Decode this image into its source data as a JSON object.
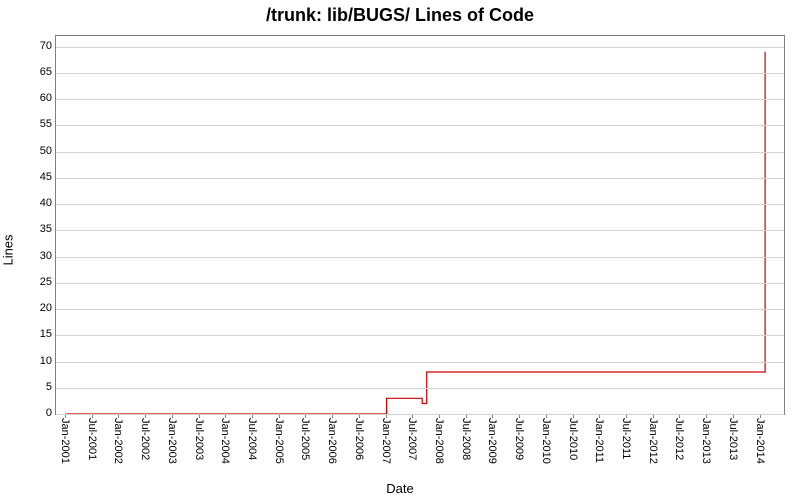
{
  "chart_data": {
    "type": "line",
    "title": "/trunk: lib/BUGS/ Lines of Code",
    "xlabel": "Date",
    "ylabel": "Lines",
    "ylim": [
      0,
      72
    ],
    "y_ticks": [
      0,
      5,
      10,
      15,
      20,
      25,
      30,
      35,
      40,
      45,
      50,
      55,
      60,
      65,
      70
    ],
    "x_categories": [
      "Jan-2001",
      "Jul-2001",
      "Jan-2002",
      "Jul-2002",
      "Jan-2003",
      "Jul-2003",
      "Jan-2004",
      "Jul-2004",
      "Jan-2005",
      "Jul-2005",
      "Jan-2006",
      "Jul-2006",
      "Jan-2007",
      "Jul-2007",
      "Jan-2008",
      "Jul-2008",
      "Jan-2009",
      "Jul-2009",
      "Jan-2010",
      "Jul-2010",
      "Jan-2011",
      "Jul-2011",
      "Jan-2012",
      "Jul-2012",
      "Jan-2013",
      "Jul-2013",
      "Jan-2014"
    ],
    "series": [
      {
        "name": "lines",
        "color": "#cc0000",
        "points": [
          {
            "x": "Jan-2001",
            "y": 0
          },
          {
            "x": "Jan-2007",
            "y": 0
          },
          {
            "x": "Jan-2007",
            "y": 3
          },
          {
            "x": "Sep-2007",
            "y": 3
          },
          {
            "x": "Sep-2007",
            "y": 2
          },
          {
            "x": "Oct-2007",
            "y": 2
          },
          {
            "x": "Oct-2007",
            "y": 8
          },
          {
            "x": "Feb-2014",
            "y": 8
          },
          {
            "x": "Feb-2014",
            "y": 69
          }
        ]
      }
    ]
  }
}
